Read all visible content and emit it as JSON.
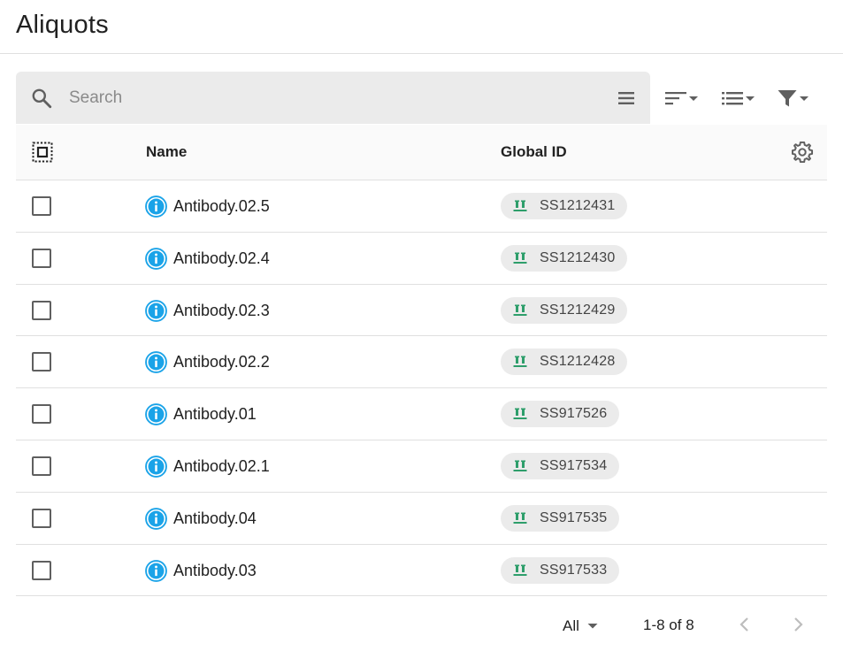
{
  "page": {
    "title": "Aliquots"
  },
  "search": {
    "placeholder": "Search",
    "value": ""
  },
  "table": {
    "columns": {
      "name": "Name",
      "global_id": "Global ID"
    },
    "rows": [
      {
        "name": "Antibody.02.5",
        "global_id": "SS1212431"
      },
      {
        "name": "Antibody.02.4",
        "global_id": "SS1212430"
      },
      {
        "name": "Antibody.02.3",
        "global_id": "SS1212429"
      },
      {
        "name": "Antibody.02.2",
        "global_id": "SS1212428"
      },
      {
        "name": "Antibody.01",
        "global_id": "SS917526"
      },
      {
        "name": "Antibody.02.1",
        "global_id": "SS917534"
      },
      {
        "name": "Antibody.04",
        "global_id": "SS917535"
      },
      {
        "name": "Antibody.03",
        "global_id": "SS917533"
      }
    ]
  },
  "pagination": {
    "rows_per_page": "All",
    "range": "1-8 of 8"
  },
  "colors": {
    "info": "#1aa3e8",
    "tube": "#2e9e6b",
    "chip_bg": "#ebebeb",
    "search_bg": "#ebebeb",
    "icon": "#5f5f5f"
  },
  "icons": [
    "search-icon",
    "menu-icon",
    "sort-icon",
    "view-list-icon",
    "filter-icon",
    "select-all-icon",
    "gear-icon",
    "info-icon",
    "tube-icon",
    "chevron-left-icon",
    "chevron-right-icon"
  ]
}
